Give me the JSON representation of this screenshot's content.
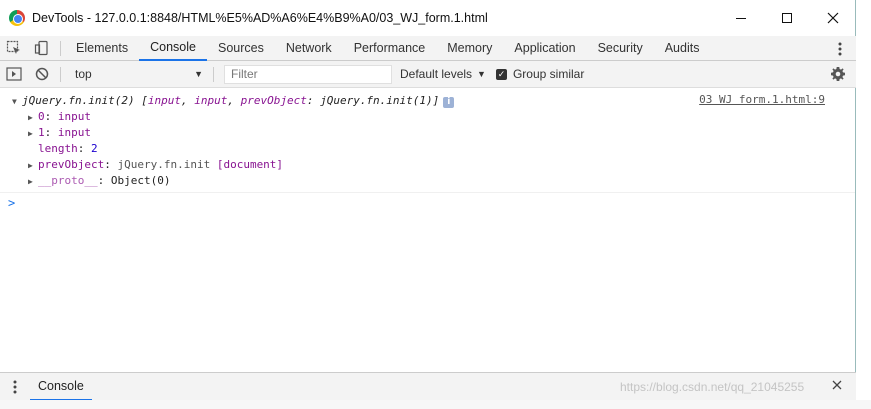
{
  "window": {
    "title": "DevTools - 127.0.0.1:8848/HTML%E5%AD%A6%E4%B9%A0/03_WJ_form.1.html"
  },
  "tabs": [
    "Elements",
    "Console",
    "Sources",
    "Network",
    "Performance",
    "Memory",
    "Application",
    "Security",
    "Audits"
  ],
  "active_tab": "Console",
  "toolbar": {
    "context": "top",
    "filter_placeholder": "Filter",
    "levels": "Default levels",
    "group_similar": "Group similar"
  },
  "console": {
    "head": "jQuery.fn.init(2)",
    "preview_items": [
      "input",
      "input"
    ],
    "preview_key": "prevObject",
    "preview_val": "jQuery.fn.init(1)",
    "source": "03 WJ form.1.html:9",
    "rows": [
      {
        "key": "0",
        "val": "input",
        "expandable": true
      },
      {
        "key": "1",
        "val": "input",
        "expandable": true
      },
      {
        "key": "length",
        "val": "2",
        "expandable": false
      },
      {
        "key": "prevObject",
        "val": "jQuery.fn.init",
        "extra": "[document]",
        "expandable": true
      },
      {
        "key": "__proto__",
        "val": "Object(0)",
        "expandable": true
      }
    ],
    "prompt": ">"
  },
  "drawer": {
    "tab": "Console",
    "watermark": "https://blog.csdn.net/qq_21045255"
  }
}
